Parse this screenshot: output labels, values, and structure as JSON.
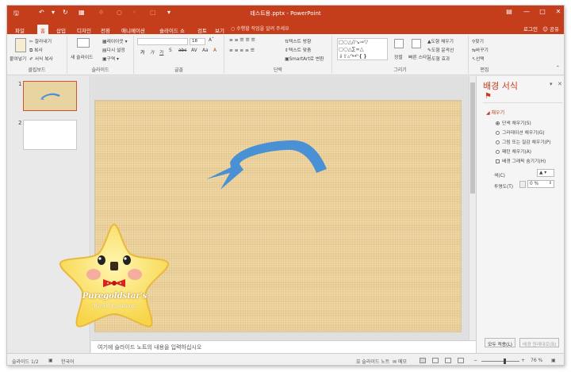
{
  "app": {
    "window_title": "테스트용.pptx - PowerPoint",
    "signin": "로그인",
    "share": "공유"
  },
  "colors": {
    "accent": "#c43e1c",
    "shape_fill": "#4a90d4",
    "slide_bg": "#ecd39e"
  },
  "tabs": [
    {
      "label": "파일"
    },
    {
      "label": "홈"
    },
    {
      "label": "삽입"
    },
    {
      "label": "디자인"
    },
    {
      "label": "전환"
    },
    {
      "label": "애니메이션"
    },
    {
      "label": "슬라이드 쇼"
    },
    {
      "label": "검토"
    },
    {
      "label": "보기"
    }
  ],
  "tell_me": "수행할 작업을 알려 주세요",
  "ribbon": {
    "clipboard": {
      "paste": "붙여넣기",
      "cut": "잘라내기",
      "copy": "복사",
      "format_painter": "서식 복사",
      "label": "클립보드"
    },
    "slides": {
      "new_slide": "새 슬라이드",
      "layout": "레이아웃",
      "reset": "다시 설정",
      "section": "구역",
      "label": "슬라이드"
    },
    "font": {
      "size": "18",
      "label": "글꼴"
    },
    "paragraph": {
      "text_direction": "텍스트 방향",
      "align_text": "텍스트 맞춤",
      "smartart": "SmartArt로 변환",
      "label": "단락"
    },
    "drawing": {
      "arrange": "정렬",
      "quick_styles": "빠른 스타일",
      "shape_fill": "도형 채우기",
      "shape_outline": "도형 윤곽선",
      "shape_effects": "도형 효과",
      "label": "그리기"
    },
    "editing": {
      "find": "찾기",
      "replace": "바꾸기",
      "select": "선택",
      "label": "편집"
    }
  },
  "thumbnails": [
    {
      "number": "1"
    },
    {
      "number": "2"
    }
  ],
  "notes_placeholder": "여기에 슬라이드 노트의 내용을 입력하십시오",
  "format_pane": {
    "title": "배경 서식",
    "section": "채우기",
    "options": [
      {
        "label": "단색 채우기(S)",
        "selected": true
      },
      {
        "label": "그라데이션 채우기(G)",
        "selected": false
      },
      {
        "label": "그림 또는 질감 채우기(P)",
        "selected": false
      },
      {
        "label": "패턴 채우기(A)",
        "selected": false
      }
    ],
    "hide_graphics": "배경 그래픽 숨기기(H)",
    "color_label": "색(C)",
    "transparency_label": "투명도(T)",
    "transparency_value": "0 %",
    "apply_all": "모두 적용(L)",
    "reset_background": "배경 원래대로(B)"
  },
  "statusbar": {
    "slide_info": "슬라이드 1/2",
    "language": "한국어",
    "notes": "슬라이드 노트",
    "comments": "메모",
    "zoom": "76 %"
  },
  "sticker": {
    "line1": "Puregoldstar's",
    "line2": "Worst Workshops"
  }
}
